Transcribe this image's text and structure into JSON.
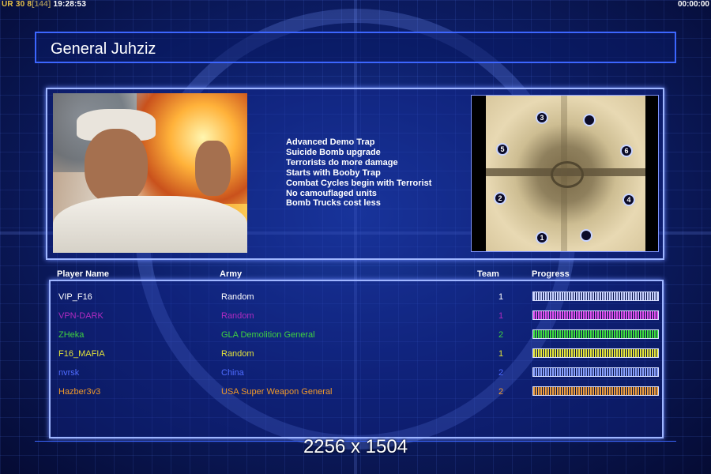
{
  "hud": {
    "left_a": "UR 30",
    "left_b": "8",
    "left_c": "[144]",
    "left_d": "19:28:53",
    "right": "00:00:00"
  },
  "general": {
    "title": "General Juhziz",
    "bonuses": [
      "Advanced Demo Trap",
      "Suicide Bomb upgrade",
      "Terrorists do more damage",
      "Starts with Booby Trap",
      "Combat Cycles begin with Terrorist",
      "No camouflaged units",
      "Bomb Trucks cost less"
    ]
  },
  "map": {
    "start_positions": [
      "1",
      "2",
      "3",
      "4",
      "5",
      "6",
      "",
      ""
    ]
  },
  "roster": {
    "headers": {
      "player": "Player Name",
      "army": "Army",
      "team": "Team",
      "progress": "Progress"
    },
    "players": [
      {
        "name": "VIP_F16",
        "army": "Random",
        "team": "1",
        "color": "#ffffff",
        "bar_color": "#c9d2ff",
        "progress": 1.0
      },
      {
        "name": "VPN-DARK",
        "army": "Random",
        "team": "1",
        "color": "#b02bc0",
        "bar_color": "#e050f0",
        "progress": 1.0
      },
      {
        "name": "ZHeka",
        "army": "GLA Demolition General",
        "team": "2",
        "color": "#3fd23f",
        "bar_color": "#3fe03f",
        "progress": 1.0
      },
      {
        "name": "F16_MAFIA",
        "army": "Random",
        "team": "1",
        "color": "#e2e23a",
        "bar_color": "#e8e83a",
        "progress": 1.0
      },
      {
        "name": "nvrsk",
        "army": "China",
        "team": "2",
        "color": "#4f6cff",
        "bar_color": "#8aa2ff",
        "progress": 1.0
      },
      {
        "name": "Hazber3v3",
        "army": "USA Super Weapon General",
        "team": "2",
        "color": "#f09a2a",
        "bar_color": "#f0a040",
        "progress": 1.0
      }
    ]
  },
  "watermark": "2256 x 1504"
}
